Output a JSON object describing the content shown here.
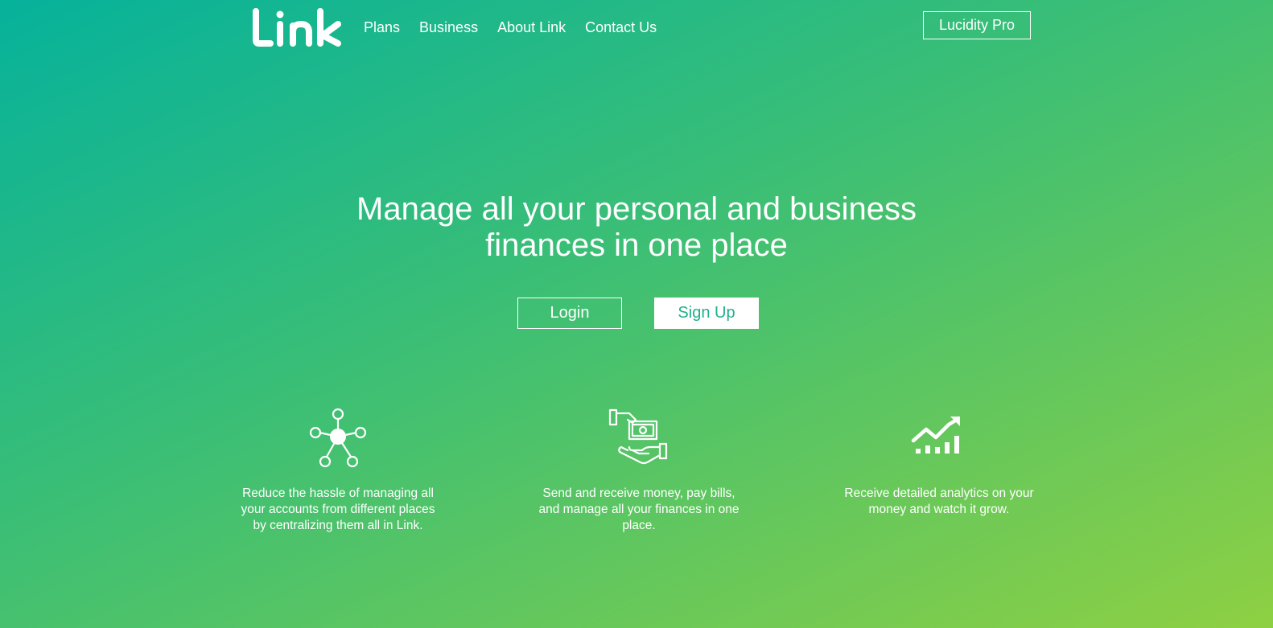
{
  "brand": {
    "logo_text": "Link"
  },
  "nav": {
    "items": [
      {
        "label": "Plans"
      },
      {
        "label": "Business"
      },
      {
        "label": "About Link"
      },
      {
        "label": "Contact Us"
      }
    ],
    "pro_button": "Lucidity Pro"
  },
  "hero": {
    "title_line1": "Manage all your personal and business",
    "title_line2": "finances in one place",
    "login_label": "Login",
    "signup_label": "Sign Up"
  },
  "features": [
    {
      "icon": "network-hub-icon",
      "text": "Reduce the hassle of managing all your accounts from different places by centralizing them all in Link."
    },
    {
      "icon": "hand-money-icon",
      "text": "Send and receive money, pay bills, and manage all your finances in one place."
    },
    {
      "icon": "growth-chart-icon",
      "text": "Receive detailed analytics on your money and watch it grow."
    }
  ],
  "colors": {
    "gradient_start": "#06b29b",
    "gradient_end": "#8ed043",
    "signup_text": "#1fb08a",
    "foreground": "#ffffff"
  }
}
